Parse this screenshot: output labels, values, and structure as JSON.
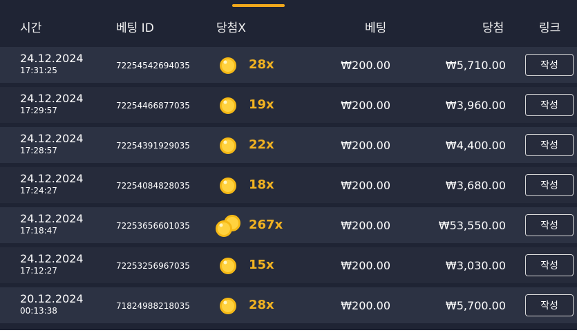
{
  "header": {
    "time": "시간",
    "bet_id": "베팅 ID",
    "multiplier": "당첨X",
    "bet": "베팅",
    "win": "당첨",
    "link": "링크"
  },
  "rows": [
    {
      "date": "24.12.2024",
      "time": "17:31:25",
      "bet_id": "72254542694035",
      "multiplier": "28x",
      "bet": "₩200.00",
      "win": "₩5,710.00",
      "link": "작성",
      "coin": "coin-icon"
    },
    {
      "date": "24.12.2024",
      "time": "17:29:57",
      "bet_id": "72254466877035",
      "multiplier": "19x",
      "bet": "₩200.00",
      "win": "₩3,960.00",
      "link": "작성",
      "coin": "coin-icon"
    },
    {
      "date": "24.12.2024",
      "time": "17:28:57",
      "bet_id": "72254391929035",
      "multiplier": "22x",
      "bet": "₩200.00",
      "win": "₩4,400.00",
      "link": "작성",
      "coin": "coin-icon"
    },
    {
      "date": "24.12.2024",
      "time": "17:24:27",
      "bet_id": "72254084828035",
      "multiplier": "18x",
      "bet": "₩200.00",
      "win": "₩3,680.00",
      "link": "작성",
      "coin": "coin-icon"
    },
    {
      "date": "24.12.2024",
      "time": "17:18:47",
      "bet_id": "72253656601035",
      "multiplier": "267x",
      "bet": "₩200.00",
      "win": "₩53,550.00",
      "link": "작성",
      "coin": "coins-stack-icon"
    },
    {
      "date": "24.12.2024",
      "time": "17:12:27",
      "bet_id": "72253256967035",
      "multiplier": "15x",
      "bet": "₩200.00",
      "win": "₩3,030.00",
      "link": "작성",
      "coin": "coin-icon"
    },
    {
      "date": "20.12.2024",
      "time": "00:13:38",
      "bet_id": "71824988218035",
      "multiplier": "28x",
      "bet": "₩200.00",
      "win": "₩5,700.00",
      "link": "작성",
      "coin": "coin-icon"
    }
  ],
  "colors": {
    "background": "#1f2434",
    "row_alt": "#2c3243",
    "row_base": "#262b3b",
    "accent": "#f2b321",
    "tab_indicator": "#f0a81c"
  }
}
